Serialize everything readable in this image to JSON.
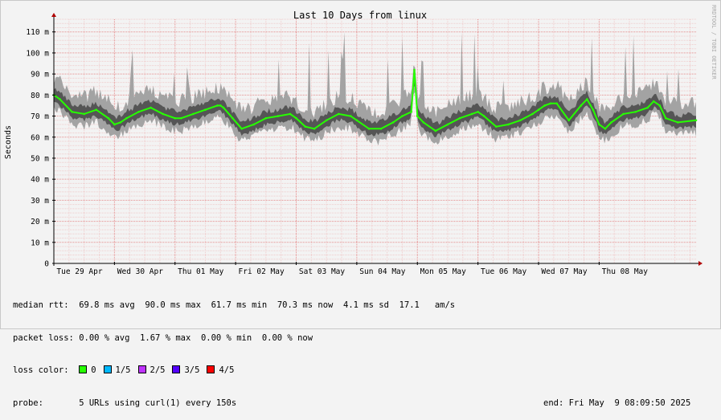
{
  "vendor_text": "RRDTOOL / TOBI OETIKER",
  "chart_data": {
    "type": "line",
    "title": "Last 10 Days from linux",
    "ylabel": "Seconds",
    "ylim": [
      0,
      116
    ],
    "y_ticks": [
      {
        "value": 0,
        "label": "0"
      },
      {
        "value": 10,
        "label": "10 m"
      },
      {
        "value": 20,
        "label": "20 m"
      },
      {
        "value": 30,
        "label": "30 m"
      },
      {
        "value": 40,
        "label": "40 m"
      },
      {
        "value": 50,
        "label": "50 m"
      },
      {
        "value": 60,
        "label": "60 m"
      },
      {
        "value": 70,
        "label": "70 m"
      },
      {
        "value": 80,
        "label": "80 m"
      },
      {
        "value": 90,
        "label": "90 m"
      },
      {
        "value": 100,
        "label": "100 m"
      },
      {
        "value": 110,
        "label": "110 m"
      }
    ],
    "x_unit": "days since 2025-04-28 17:36",
    "xlim": [
      0,
      10.6
    ],
    "x_ticks": [
      {
        "value": 0.0,
        "label": "Tue 29 Apr"
      },
      {
        "value": 1.0,
        "label": "Wed 30 Apr"
      },
      {
        "value": 2.0,
        "label": "Thu 01 May"
      },
      {
        "value": 3.0,
        "label": "Fri 02 May"
      },
      {
        "value": 4.0,
        "label": "Sat 03 May"
      },
      {
        "value": 5.0,
        "label": "Sun 04 May"
      },
      {
        "value": 6.0,
        "label": "Mon 05 May"
      },
      {
        "value": 7.0,
        "label": "Tue 06 May"
      },
      {
        "value": 8.0,
        "label": "Wed 07 May"
      },
      {
        "value": 9.0,
        "label": "Thu 08 May"
      }
    ],
    "grid": true,
    "median_rtt": [
      [
        0.0,
        80
      ],
      [
        0.1,
        78
      ],
      [
        0.3,
        72
      ],
      [
        0.5,
        71
      ],
      [
        0.7,
        73
      ],
      [
        0.9,
        69
      ],
      [
        1.0,
        66
      ],
      [
        1.1,
        67
      ],
      [
        1.2,
        69
      ],
      [
        1.4,
        72
      ],
      [
        1.6,
        74
      ],
      [
        1.8,
        71
      ],
      [
        2.0,
        69
      ],
      [
        2.1,
        69
      ],
      [
        2.3,
        71
      ],
      [
        2.5,
        73
      ],
      [
        2.7,
        75
      ],
      [
        2.75,
        75
      ],
      [
        2.8,
        74
      ],
      [
        2.95,
        69
      ],
      [
        3.1,
        64
      ],
      [
        3.3,
        66
      ],
      [
        3.5,
        69
      ],
      [
        3.7,
        70
      ],
      [
        3.9,
        71
      ],
      [
        4.0,
        69
      ],
      [
        4.15,
        65
      ],
      [
        4.3,
        64
      ],
      [
        4.5,
        68
      ],
      [
        4.7,
        71
      ],
      [
        4.9,
        70
      ],
      [
        5.0,
        68
      ],
      [
        5.2,
        64
      ],
      [
        5.4,
        64
      ],
      [
        5.6,
        67
      ],
      [
        5.75,
        70
      ],
      [
        5.9,
        72
      ],
      [
        5.95,
        92
      ],
      [
        6.0,
        70
      ],
      [
        6.1,
        67
      ],
      [
        6.3,
        63
      ],
      [
        6.5,
        66
      ],
      [
        6.7,
        69
      ],
      [
        6.9,
        71
      ],
      [
        7.0,
        72
      ],
      [
        7.1,
        70
      ],
      [
        7.3,
        65
      ],
      [
        7.5,
        66
      ],
      [
        7.7,
        68
      ],
      [
        7.9,
        71
      ],
      [
        8.0,
        73
      ],
      [
        8.1,
        75
      ],
      [
        8.2,
        76
      ],
      [
        8.3,
        76
      ],
      [
        8.5,
        68
      ],
      [
        8.7,
        75
      ],
      [
        8.8,
        78
      ],
      [
        8.9,
        73
      ],
      [
        9.0,
        66
      ],
      [
        9.1,
        64
      ],
      [
        9.2,
        67
      ],
      [
        9.4,
        71
      ],
      [
        9.6,
        72
      ],
      [
        9.8,
        74
      ],
      [
        9.9,
        77
      ],
      [
        10.0,
        75
      ],
      [
        10.1,
        69
      ],
      [
        10.3,
        67
      ],
      [
        10.6,
        68
      ]
    ],
    "legend_placement": "bottom"
  },
  "stats": {
    "median_rtt": {
      "label": "median rtt:",
      "avg": "69.8 ms avg",
      "max": "90.0 ms max",
      "min": "61.7 ms min",
      "now": "70.3 ms now",
      "sd": "4.1 ms sd",
      "am": "17.1   am/s"
    },
    "packet_loss": {
      "label": "packet loss:",
      "avg": "0.00 % avg",
      "max": "1.67 % max",
      "min": "0.00 % min",
      "now": "0.00 % now"
    },
    "loss_color": {
      "label": "loss color:",
      "items": [
        {
          "label": "0",
          "color": "#26ff00"
        },
        {
          "label": "1/5",
          "color": "#00b8ff"
        },
        {
          "label": "2/5",
          "color": "#bf33ff"
        },
        {
          "label": "3/5",
          "color": "#5500ff"
        },
        {
          "label": "4/5",
          "color": "#ff0000"
        }
      ]
    },
    "probe": {
      "label": "probe:",
      "text": "5 URLs using curl(1) every 150s",
      "end": "end: Fri May  9 08:09:50 2025"
    }
  },
  "colors": {
    "outer_band": "#a3a3a3",
    "inner_band": "#555555",
    "median_line": "#26ff00",
    "grid_major": "#e58c8c",
    "grid_minor": "#f0cccc",
    "axis": "#000000",
    "arrow": "#b00000"
  }
}
